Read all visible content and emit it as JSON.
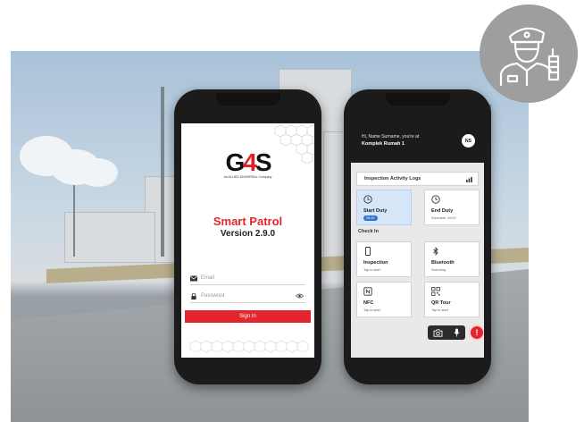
{
  "colors": {
    "accent": "#e3262e",
    "active_card": "#d6e6f9",
    "pill": "#2d73d3",
    "badge": "#9e9e9e"
  },
  "badge": {
    "icon": "security-guard-icon"
  },
  "login": {
    "logo_text_1": "G",
    "logo_text_2": "4",
    "logo_text_3": "S",
    "logo_sub": "An ALLIED UNIVERSAL Company",
    "app_title": "Smart Patrol",
    "version": "Version 2.9.0",
    "email_placeholder": "Email",
    "password_placeholder": "Password",
    "signin_label": "Sign In"
  },
  "dashboard": {
    "greeting": "Hi, Name Surname, you're at",
    "location": "Komplek Rumah 1",
    "avatar_initials": "NS",
    "logs_label": "Inspection Activity Logs",
    "check_in_label": "Check In",
    "cards": [
      {
        "title": "Start Duty",
        "sub": "08:49",
        "icon": "clock-icon"
      },
      {
        "title": "End Duty",
        "sub": "Schedule: 19:00",
        "icon": "clock-icon"
      },
      {
        "title": "Inspection",
        "sub": "Tap to start",
        "icon": "phone-icon"
      },
      {
        "title": "Bluetooth",
        "sub": "Scanning",
        "icon": "bluetooth-icon"
      },
      {
        "title": "NFC",
        "sub": "Tap to start",
        "icon": "nfc-icon"
      },
      {
        "title": "QR Tour",
        "sub": "Tap to start",
        "icon": "qr-code-icon"
      }
    ],
    "sos_label": "!"
  }
}
